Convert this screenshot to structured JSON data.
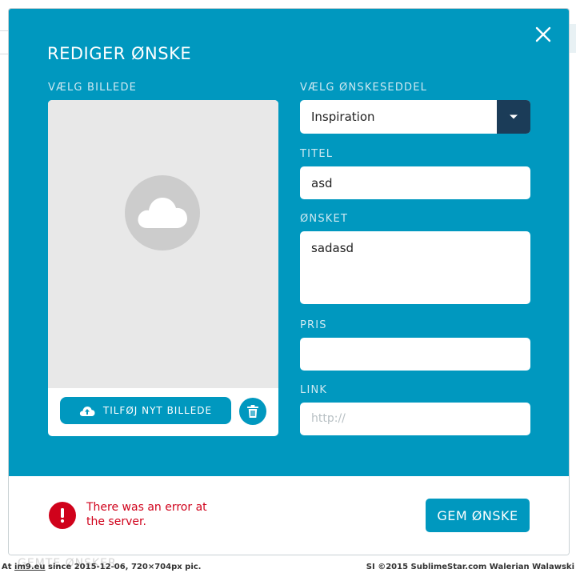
{
  "background": {
    "bottom_text": "GEMTE ØNSKER"
  },
  "modal": {
    "title": "REDIGER ØNSKE",
    "image_section": {
      "label": "VÆLG BILLEDE",
      "add_button_label": "TILFØJ NYT BILLEDE"
    },
    "wishlist": {
      "label": "VÆLG ØNSKESEDDEL",
      "selected": "Inspiration"
    },
    "title_field": {
      "label": "TITEL",
      "value": "asd"
    },
    "wish_field": {
      "label": "ØNSKET",
      "value": "sadasd"
    },
    "price_field": {
      "label": "PRIS",
      "value": ""
    },
    "link_field": {
      "label": "LINK",
      "value": "",
      "placeholder": "http://"
    },
    "error_message": "There was an error at the server.",
    "save_button_label": "GEM ØNSKE"
  },
  "caption": {
    "left_prefix": "At ",
    "left_site": "im9.eu",
    "left_suffix": " since 2015-12-06, 720×704px pic.",
    "right": "SI ©2015 SublimeStar.com Walerian Walawski"
  },
  "colors": {
    "primary": "#0098bf",
    "dark_navy": "#1b3c58",
    "error": "#d0021b",
    "placeholder_grey": "#e8e8e8"
  },
  "icons": {
    "close": "close-icon",
    "cloud": "cloud-icon",
    "upload": "cloud-upload-icon",
    "trash": "trash-icon",
    "dropdown": "caret-down-icon",
    "error": "exclamation-icon"
  }
}
